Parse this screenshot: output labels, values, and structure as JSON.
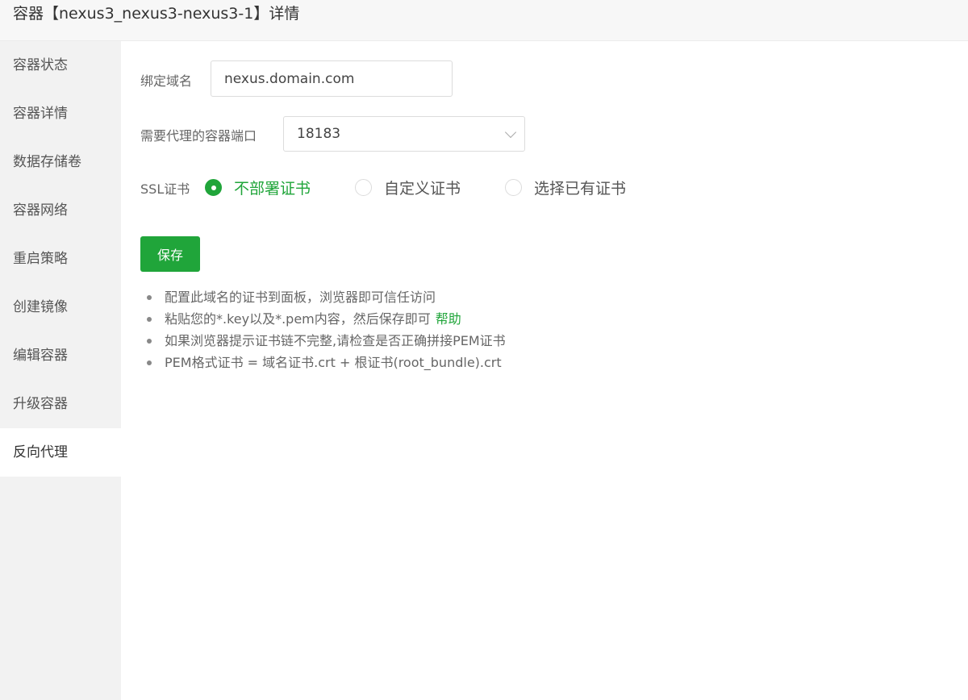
{
  "header": {
    "title": "容器【nexus3_nexus3-nexus3-1】详情"
  },
  "sidebar": {
    "items": [
      {
        "label": "容器状态"
      },
      {
        "label": "容器详情"
      },
      {
        "label": "数据存储卷"
      },
      {
        "label": "容器网络"
      },
      {
        "label": "重启策略"
      },
      {
        "label": "创建镜像"
      },
      {
        "label": "编辑容器"
      },
      {
        "label": "升级容器"
      },
      {
        "label": "反向代理",
        "active": true
      }
    ]
  },
  "form": {
    "domain_label": "绑定域名",
    "domain_value": "nexus.domain.com",
    "port_label": "需要代理的容器端口",
    "port_value": "18183",
    "ssl_label": "SSL证书",
    "ssl_options": [
      {
        "label": "不部署证书",
        "checked": true
      },
      {
        "label": "自定义证书",
        "checked": false
      },
      {
        "label": "选择已有证书",
        "checked": false
      }
    ],
    "save_label": "保存"
  },
  "tips": {
    "items": [
      "配置此域名的证书到面板，浏览器即可信任访问",
      "粘贴您的*.key以及*.pem内容，然后保存即可",
      "如果浏览器提示证书链不完整,请检查是否正确拼接PEM证书",
      "PEM格式证书 = 域名证书.crt + 根证书(root_bundle).crt"
    ],
    "help_link": "帮助"
  },
  "colors": {
    "accent": "#20a53a",
    "sidebar_bg": "#f2f2f2",
    "header_bg": "#f7f7f7"
  }
}
